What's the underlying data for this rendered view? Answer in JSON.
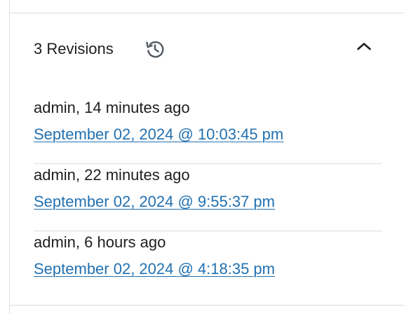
{
  "panel": {
    "title": "3 Revisions",
    "history_icon": "history-icon",
    "toggle_icon": "chevron-up-icon",
    "expanded": true
  },
  "revisions": [
    {
      "meta": "admin, 14 minutes ago",
      "date": "September 02, 2024 @ 10:03:45 pm"
    },
    {
      "meta": "admin, 22 minutes ago",
      "date": "September 02, 2024 @ 9:55:37 pm"
    },
    {
      "meta": "admin, 6 hours ago",
      "date": "September 02, 2024 @ 4:18:35 pm"
    }
  ],
  "colors": {
    "text": "#1e1e1e",
    "link": "#2271b1",
    "divider": "#dcdcde",
    "icon": "#50575e"
  }
}
